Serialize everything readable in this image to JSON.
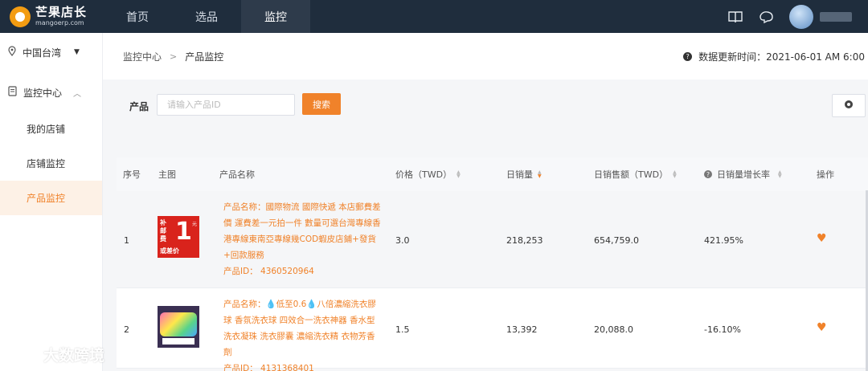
{
  "brand": {
    "name": "芒果店长",
    "sub": "mangoerp.com"
  },
  "nav": [
    {
      "label": "首页",
      "active": false
    },
    {
      "label": "选品",
      "active": false
    },
    {
      "label": "监控",
      "active": true
    }
  ],
  "sidebar": {
    "region": "中国台湾",
    "group": "监控中心",
    "items": [
      {
        "label": "我的店铺",
        "active": false
      },
      {
        "label": "店铺监控",
        "active": false
      },
      {
        "label": "产品监控",
        "active": true
      }
    ]
  },
  "breadcrumb": {
    "parent": "监控中心",
    "current": "产品监控"
  },
  "update_time": "数据更新时间：2021-06-01 AM 6:00",
  "filter": {
    "label": "产品",
    "placeholder": "请输入产品ID",
    "search_label": "搜索"
  },
  "table": {
    "headers": {
      "index": "序号",
      "image": "主图",
      "name": "产品名称",
      "price": "价格（TWD）",
      "daily_sales": "日销量",
      "daily_revenue": "日销售额（TWD）",
      "growth": "日销量增长率",
      "action": "操作"
    },
    "rows": [
      {
        "index": "1",
        "name": "产品名称：國際物流 國際快遞 本店郵費差價 運費差一元拍一件 數量可選台灣專線香港專線東南亞專線幾COD蝦皮店鋪+發貨+回款服務",
        "id": "产品ID： 4360520964",
        "price": "3.0",
        "daily_sales": "218,253",
        "daily_revenue": "654,759.0",
        "growth": "421.95%",
        "thumb": {
          "left_text": "补邮费",
          "big": "1",
          "unit": "元",
          "bottom": "或差价"
        }
      },
      {
        "index": "2",
        "name": "产品名称：💧低至0.6💧八倍濃縮洗衣膠球 香氛洗衣球 四效合一洗衣神器 香水型洗衣凝珠 洗衣膠囊 濃縮洗衣精 衣物芳香劑",
        "id": "产品ID： 4131368401",
        "price": "1.5",
        "daily_sales": "13,392",
        "daily_revenue": "20,088.0",
        "growth": "-16.10%"
      }
    ]
  },
  "watermark": "大数跨境",
  "colors": {
    "accent": "#f0822a",
    "topbar": "#1f2d3d"
  }
}
